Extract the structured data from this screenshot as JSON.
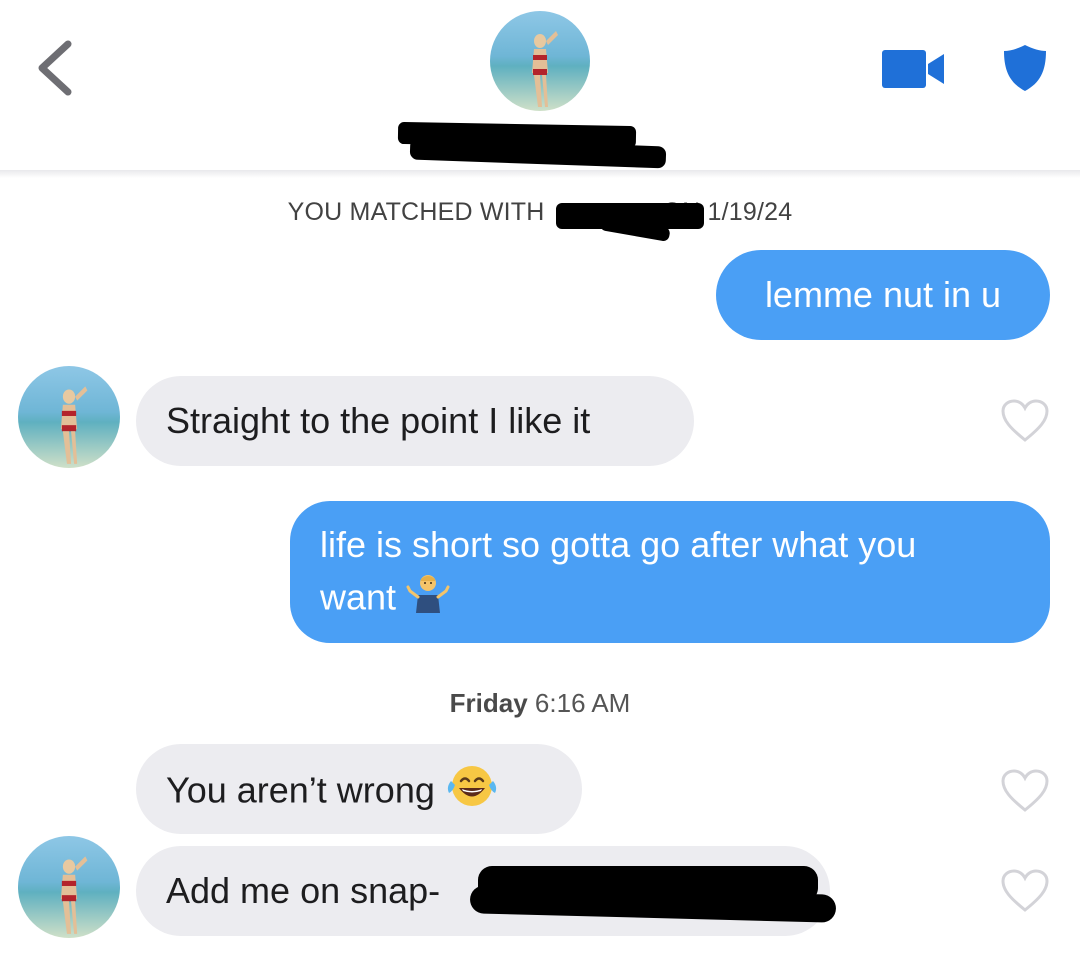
{
  "header": {
    "back_icon": "chevron-left-icon",
    "video_icon": "video-camera-icon",
    "safety_icon": "shield-icon",
    "accent_color": "#1f70d8"
  },
  "match_banner": {
    "prefix": "YOU MATCHED WITH",
    "suffix": "ON 1/19/24"
  },
  "messages": [
    {
      "side": "sent",
      "text": "lemme nut in u"
    },
    {
      "side": "received",
      "text": "Straight to the point I like it"
    },
    {
      "side": "sent",
      "text": "life is short so gotta go after what you want",
      "line1": "life is short so gotta go after what you",
      "line2": "want",
      "emoji": "person-shrugging-emoji"
    },
    {
      "side": "received",
      "text": "You aren’t wrong",
      "emoji": "laughing-tears-emoji"
    },
    {
      "side": "received",
      "text": "Add me on snap-"
    }
  ],
  "timestamp": {
    "day": "Friday",
    "time": "6:16 AM"
  },
  "colors": {
    "sent_bubble": "#4a9ff5",
    "received_bubble": "#ececf0"
  }
}
